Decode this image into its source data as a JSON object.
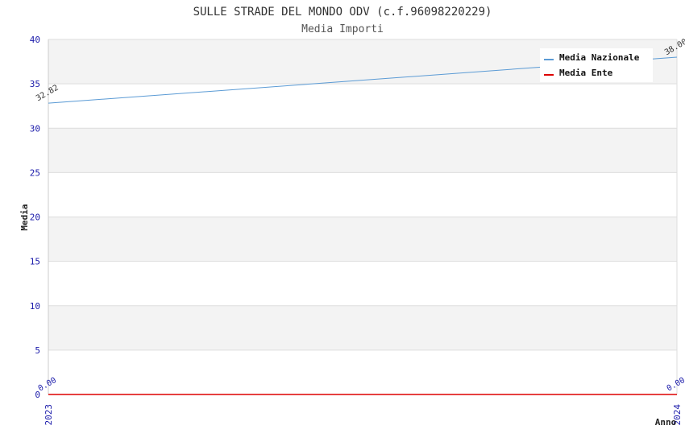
{
  "chart_data": {
    "type": "line",
    "title": "SULLE STRADE DEL MONDO ODV (c.f.96098220229)",
    "subtitle": "Media Importi",
    "xlabel": "Anno",
    "ylabel": "Media",
    "categories": [
      "2023",
      "2024"
    ],
    "ylim": [
      0,
      40
    ],
    "yticks": [
      "0",
      "5",
      "10",
      "15",
      "20",
      "25",
      "30",
      "35",
      "40"
    ],
    "grid": true,
    "legend_position": "top-right",
    "series": [
      {
        "name": "Media Nazionale",
        "color": "#5b9bd5",
        "values": [
          32.82,
          38.0
        ],
        "labels": [
          "32.82",
          "38.00"
        ]
      },
      {
        "name": "Media Ente",
        "color": "#dd0000",
        "values": [
          0,
          0
        ],
        "labels": [
          "0.00",
          "0.00"
        ]
      }
    ]
  }
}
